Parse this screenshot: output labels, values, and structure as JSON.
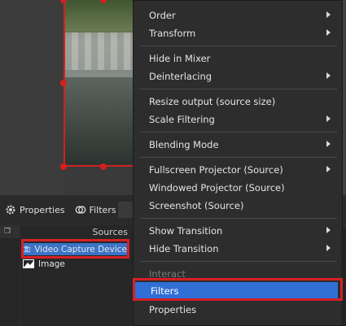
{
  "propbar": {
    "properties_label": "Properties",
    "filters_label": "Filters"
  },
  "sources": {
    "title": "Sources",
    "items": [
      {
        "label": "Video Capture Device",
        "icon": "camera-icon",
        "selected": true
      },
      {
        "label": "Image",
        "icon": "image-icon",
        "selected": false
      }
    ]
  },
  "context_menu": {
    "order": "Order",
    "transform": "Transform",
    "hide_in_mixer": "Hide in Mixer",
    "deinterlacing": "Deinterlacing",
    "resize_output": "Resize output (source size)",
    "scale_filtering": "Scale Filtering",
    "blending_mode": "Blending Mode",
    "fullscreen_projector": "Fullscreen Projector (Source)",
    "windowed_projector": "Windowed Projector (Source)",
    "screenshot": "Screenshot (Source)",
    "show_transition": "Show Transition",
    "hide_transition": "Hide Transition",
    "interact": "Interact",
    "filters": "Filters",
    "properties": "Properties"
  },
  "colors": {
    "highlight": "#2f6fd6",
    "annotation_red": "#d42027",
    "menu_bg": "#2d2d2d"
  }
}
